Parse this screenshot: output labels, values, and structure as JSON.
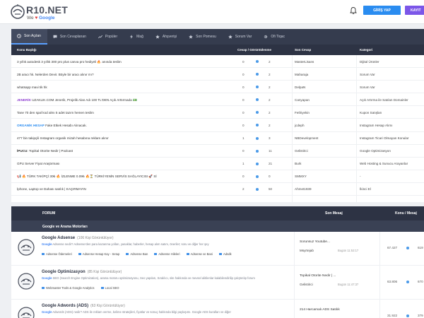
{
  "header": {
    "logo_text": "R10.NET",
    "logo_sub_prefix": "We",
    "logo_sub_heart": "♥",
    "logo_sub_brand": "Google",
    "login_label": "GİRİŞ YAP",
    "register_label": "KAYIT"
  },
  "tabs": [
    {
      "label": "Son Açılan",
      "icon": "clock-icon",
      "active": true
    },
    {
      "label": "Son Cevaplanan",
      "icon": "chat-icon",
      "active": false
    },
    {
      "label": "Popüler",
      "icon": "trend-icon",
      "active": false
    },
    {
      "label": "Mağ",
      "icon": "bolt-icon",
      "active": false
    },
    {
      "label": "Ahşverişi",
      "icon": "star-icon",
      "active": false
    },
    {
      "label": "Son Pomesu",
      "icon": "star-icon",
      "active": false
    },
    {
      "label": "Sorum Var",
      "icon": "star-icon",
      "active": false
    },
    {
      "label": "Ofi Tiqac",
      "icon": "gear-icon",
      "active": false
    }
  ],
  "topics_table": {
    "headers": {
      "title": "Konu Başlığı",
      "views_replies": "Cevap / Görüntülenme",
      "last_reply": "Son Cevap",
      "category": "Kategori"
    },
    "rows": [
      {
        "prefix": "",
        "title": "3 yıllık autodesk 3 yıllık 300 pro plus canva pro hediyeli 🔥 anında teslim",
        "views": "0",
        "replies": "2",
        "last": "MasterLisans",
        "category": "Dijital Ürünler"
      },
      {
        "prefix": "",
        "title": "2B aracı hk. Nelerden Devir. Böyle bir aracı alınır mı?",
        "views": "0",
        "replies": "2",
        "last": "Maharaja",
        "category": "Sorum Var"
      },
      {
        "prefix": "",
        "title": "whatsapp mavi tik hk",
        "views": "0",
        "replies": "2",
        "last": "DelpaN",
        "category": "Sorum Var"
      },
      {
        "prefix": "JENERİK",
        "prefix_color": "#8e3fd0",
        "title": " UZAKLIK.COM Jenerik, Projelik Alan Adı 100 TL'DEN Açık Arttırmada 💵",
        "views": "0",
        "replies": "2",
        "last": "Canyapan",
        "category": "Açık Artırma ile Satılan Domainler"
      },
      {
        "prefix": "",
        "title": "Tane 70 den spal kod almı 5 adet tazım hemen teslim",
        "views": "0",
        "replies": "2",
        "last": "Fethiyekin",
        "category": "Kupon Satışları"
      },
      {
        "prefix": "ORGANİK HESAP",
        "prefix_color": "#2a8cf0",
        "title": " Fake Etkek Hesabı Alınacak.",
        "views": "0",
        "replies": "2",
        "last": "jcdeph",
        "category": "Instagram Hesap Alımı"
      },
      {
        "prefix": "",
        "title": "477 bin takipçili Instagram organik mizah hesabına reklam alınır",
        "views": "1",
        "replies": "3",
        "last": "NBDevelopment",
        "category": "Instagram Ticari Olmayan Konular"
      },
      {
        "prefix": "İPUCU:",
        "prefix_color": "#333333",
        "title": " Topikal Otorite Nedir | Podcast",
        "views": "0",
        "replies": "11",
        "last": "Gelistirici",
        "category": "Google Optimizasyon"
      },
      {
        "prefix": "",
        "title": "GPU Server Fiyat Araştırması",
        "views": "1",
        "replies": "21",
        "last": "Burk",
        "category": "Web Hosting & Sunucu Arayanlar"
      },
      {
        "prefix": "",
        "title": "📢 🔥 TÜRK TAKİPÇİ 30₺ 🔥 İZLENME 0.09₺ 🔥⏳ TÜRKİYENİN SERVİS SAĞLAYICISI 🚀 Sİ",
        "views": "0",
        "replies": "0",
        "last": "SMMXY",
        "category": "-"
      },
      {
        "prefix": "",
        "title": "İphone, Laptop ve Dahası satılık | KAÇIRMAYIN",
        "views": "2",
        "replies": "50",
        "last": "Ahmet1939",
        "category": "İkinci El"
      }
    ]
  },
  "forum_table": {
    "headers": {
      "forum": "FORUM",
      "last_post": "Son Mesaj",
      "stats": "Konu / Mesaj"
    },
    "section_title": "Google ve Arama Motorları",
    "forums": [
      {
        "title": "Google Adsense",
        "viewing": "(106 Kişi Görüntülüyor)",
        "desc_brand": "Google",
        "desc": " Adsense nedir? Adsense'den para kazanma yolları, yasaklar, haberler, hesap alım satım, öneriler; soru ve diğer her şey",
        "subs": [
          "Adsense Ödemeleri",
          "Adsense Hesap Kay - Setup",
          "Adsense Ban",
          "Adsense Hileleri",
          "Adsense ve Bani",
          "Adsdk"
        ],
        "last_title": "Sorunsuz Youtube...",
        "last_user": "Msyrtejab",
        "last_date": "Bugün 11:53:17",
        "topics": "67.427",
        "posts": "619"
      },
      {
        "title": "Google Optimizasyon",
        "viewing": "(85 Kişi Görüntülüyor)",
        "desc_brand": "Google",
        "desc": " SEO (Search Engine Optimization), arama motoru optimizasyonu, Seo yapıları, Sıralılıcı, site hakkında ve mevsel alitilenlar kalabilendirilip çalıştırılıp forum",
        "subs": [
          "Webmaster Tools & Google Analytics",
          "Local SEO"
        ],
        "last_title": "Topikal Otorite Nedir | ...",
        "last_user": "Gelistirici",
        "last_date": "Bugün 11:47:37",
        "topics": "63.806",
        "posts": "670"
      },
      {
        "title": "Google Adwords (ADS)",
        "viewing": "(63 Kişi Görüntülüyor)",
        "desc_brand": "Google",
        "desc": " Adwords (ADS) nedir? ADS ile reklam verme, kelime stratejileri, fiyatlar ve sonuç hakkında bilgi paylaşımı. Google ADS kuralları ve diğer",
        "subs": [],
        "last_title": "214 Harcamalı ADS Satılık",
        "last_user": "",
        "last_date": "",
        "topics": "31.922",
        "posts": "379"
      }
    ]
  }
}
